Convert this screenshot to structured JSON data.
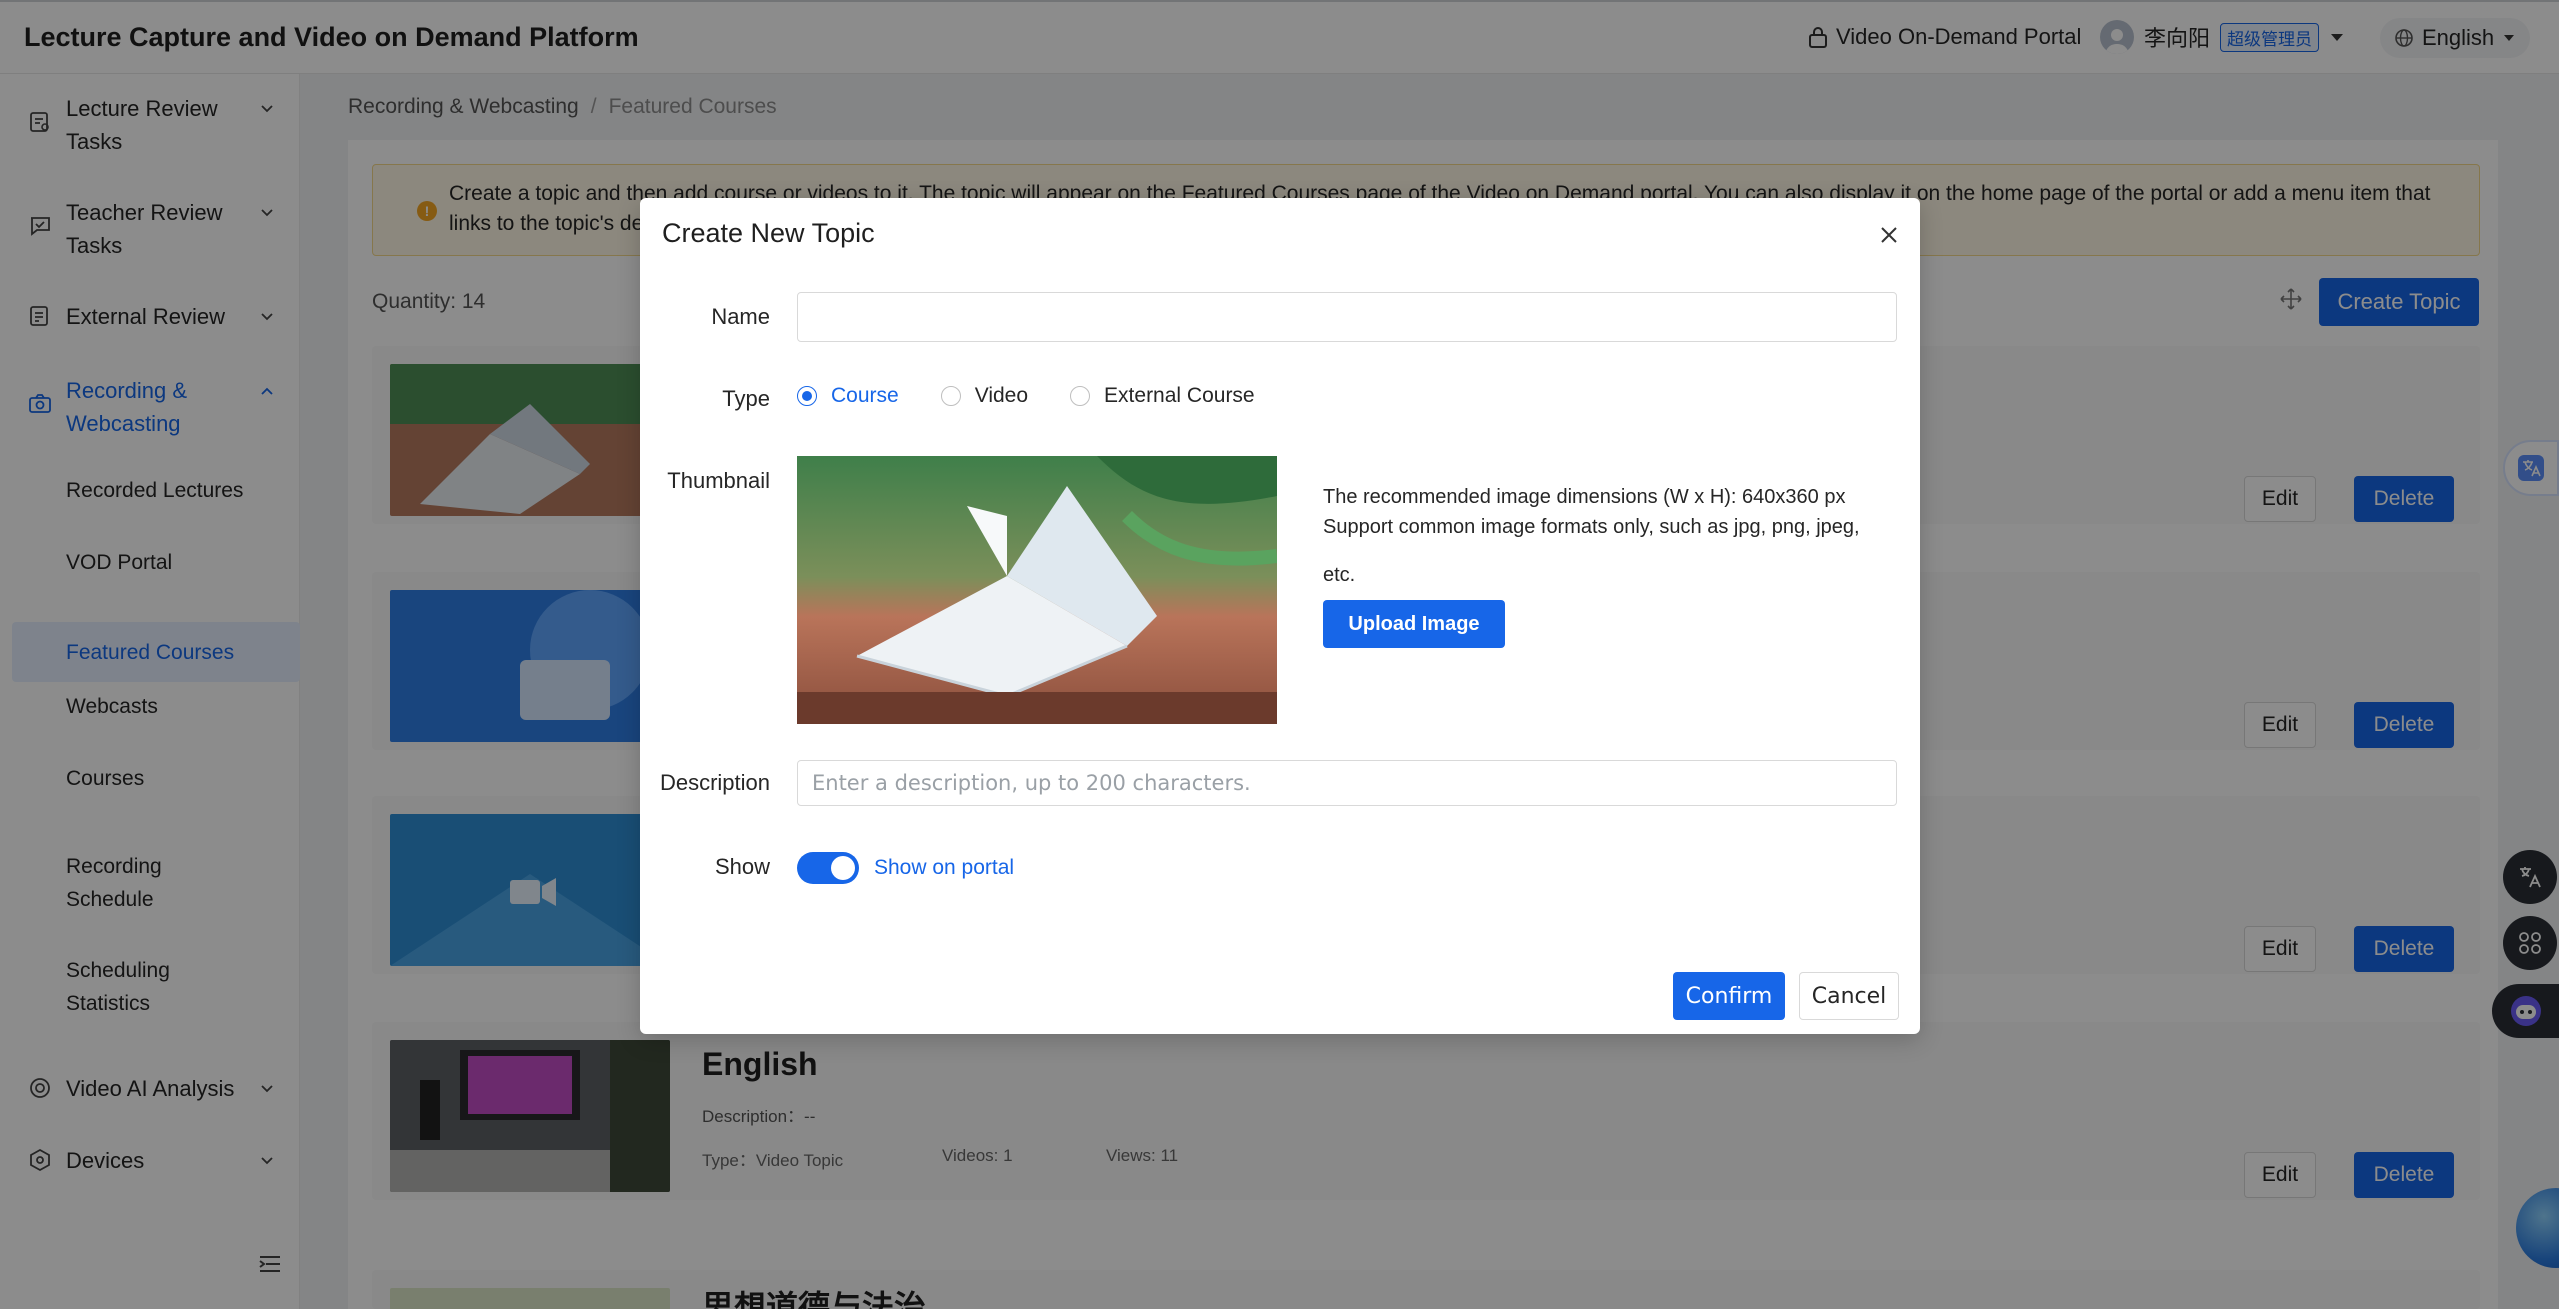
{
  "header": {
    "app_title": "Lecture Capture and Video on Demand Platform",
    "portal_link": "Video On-Demand Portal",
    "user_name": "李向阳",
    "user_role": "超级管理员",
    "language": "English"
  },
  "sidebar": {
    "groups": [
      {
        "label": "Lecture Review Tasks",
        "icon": "review-task-icon"
      },
      {
        "label": "Teacher Review Tasks",
        "icon": "teacher-review-icon"
      },
      {
        "label": "External Review",
        "icon": "external-review-icon"
      },
      {
        "label": "Recording & Webcasting",
        "icon": "camera-icon",
        "expanded": true
      },
      {
        "label": "Video AI Analysis",
        "icon": "ai-analysis-icon"
      },
      {
        "label": "Devices",
        "icon": "device-icon"
      }
    ],
    "sub_items": [
      "Recorded Lectures",
      "VOD Portal",
      "Featured Courses",
      "Webcasts",
      "Courses",
      "Recording Schedule",
      "Scheduling Statistics"
    ],
    "selected_sub_item": "Featured Courses"
  },
  "breadcrumb": {
    "parent": "Recording & Webcasting",
    "separator": "/",
    "current": "Featured Courses"
  },
  "notice": {
    "text": "Create a topic and then add course or videos to it. The topic will appear on the Featured Courses page of the Video on Demand portal. You can also display it on the home page of the portal or add a menu item that links to the topic's de"
  },
  "list": {
    "quantity": "Quantity: 14",
    "create_button": "Create Topic",
    "edit_label": "Edit",
    "delete_label": "Delete",
    "cards": [
      {
        "title": "English",
        "description": "Description：--",
        "type": "Type：Video Topic",
        "videos": "Videos: 1",
        "views": "Views: 11"
      },
      {
        "title": "思想道德与法治"
      }
    ]
  },
  "modal": {
    "title": "Create New Topic",
    "name_label": "Name",
    "name_value": "",
    "type_label": "Type",
    "type_options": [
      "Course",
      "Video",
      "External Course"
    ],
    "type_selected": "Course",
    "thumbnail_label": "Thumbnail",
    "hint_dimensions": "The recommended image dimensions (W x H): 640x360 px",
    "hint_formats_line1": "Support common image formats only, such as jpg, png, jpeg,",
    "hint_formats_line2": "etc.",
    "upload_button": "Upload Image",
    "description_label": "Description",
    "description_placeholder": "Enter a description, up to 200 characters.",
    "show_label": "Show",
    "show_toggle_on": true,
    "show_toggle_text": "Show on portal",
    "confirm_button": "Confirm",
    "cancel_button": "Cancel"
  },
  "colors": {
    "primary": "#1766e8",
    "overlay": "rgba(0,0,0,0.45)",
    "notice_bg": "#fff8e6"
  }
}
